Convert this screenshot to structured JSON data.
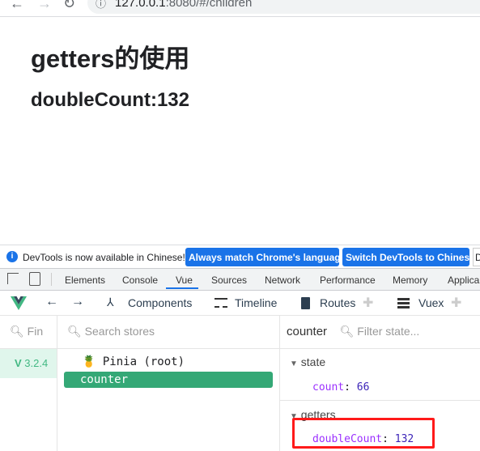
{
  "browser": {
    "url_host": "127.0.0.1",
    "url_rest": ":8080/#/children"
  },
  "page": {
    "title": "getters的使用",
    "subtitle": "doubleCount:132"
  },
  "infobar": {
    "message": "DevTools is now available in Chinese!",
    "btn_match": "Always match Chrome's language",
    "btn_switch": "Switch DevTools to Chinese",
    "btn_more": "D"
  },
  "devtools_tabs": [
    "Elements",
    "Console",
    "Vue",
    "Sources",
    "Network",
    "Performance",
    "Memory",
    "Applica"
  ],
  "active_tab": "Vue",
  "vue_toolbar": {
    "components": "Components",
    "timeline": "Timeline",
    "routes": "Routes",
    "vuex": "Vuex"
  },
  "left": {
    "search_placeholder": "Fin",
    "version": "3.2.4"
  },
  "stores": {
    "search_placeholder": "Search stores",
    "root": "Pinia (root)",
    "selected": "counter"
  },
  "inspector": {
    "title": "counter",
    "filter_placeholder": "Filter state...",
    "state_label": "state",
    "state_key": "count",
    "state_value": "66",
    "getters_label": "getters",
    "getter_key": "doubleCount",
    "getter_value": "132"
  },
  "colors": {
    "vue_green": "#42b883",
    "selected_bg": "#34a876",
    "accent_blue": "#1a73e8",
    "highlight_box": "#ff0000"
  }
}
